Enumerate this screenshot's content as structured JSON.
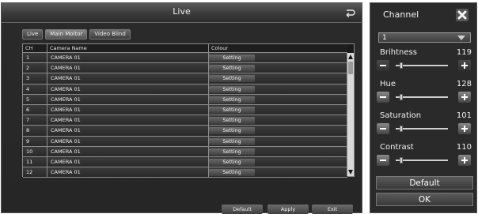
{
  "window": {
    "title": "Live"
  },
  "tabs": [
    {
      "label": "Live",
      "active": false
    },
    {
      "label": "Main Moitor",
      "active": true
    },
    {
      "label": "Video Blind",
      "active": false
    }
  ],
  "table": {
    "columns": [
      "CH",
      "Camera Name",
      "Colour"
    ],
    "rows": [
      {
        "ch": "1",
        "name": "CAMERA 01",
        "action": "Setting"
      },
      {
        "ch": "2",
        "name": "CAMERA 01",
        "action": "Setting"
      },
      {
        "ch": "3",
        "name": "CAMERA 01",
        "action": "Setting"
      },
      {
        "ch": "4",
        "name": "CAMERA 01",
        "action": "Setting"
      },
      {
        "ch": "5",
        "name": "CAMERA 01",
        "action": "Setting"
      },
      {
        "ch": "6",
        "name": "CAMERA 01",
        "action": "Setting"
      },
      {
        "ch": "7",
        "name": "CAMERA 01",
        "action": "Setting"
      },
      {
        "ch": "8",
        "name": "CAMERA 01",
        "action": "Setting"
      },
      {
        "ch": "9",
        "name": "CAMERA 01",
        "action": "Setting"
      },
      {
        "ch": "10",
        "name": "CAMERA 01",
        "action": "Setting"
      },
      {
        "ch": "11",
        "name": "CAMERA 01",
        "action": "Setting"
      },
      {
        "ch": "12",
        "name": "CAMERA 01",
        "action": "Setting"
      }
    ]
  },
  "footer": {
    "default_label": "Default",
    "apply_label": "Apply",
    "exit_label": "Exit"
  },
  "panel": {
    "title": "Channel",
    "channel_value": "1",
    "sliders": [
      {
        "label": "Brihtness",
        "value": "119",
        "level": 0.08
      },
      {
        "label": "Hue",
        "value": "128",
        "level": 0.08
      },
      {
        "label": "Saturation",
        "value": "101",
        "level": 0.08
      },
      {
        "label": "Contrast",
        "value": "110",
        "level": 0.08
      }
    ],
    "default_label": "Default",
    "ok_label": "OK"
  },
  "colors": {
    "background": "#2a2a2a",
    "border": "#8c8c8c",
    "text": "#ffffff"
  }
}
